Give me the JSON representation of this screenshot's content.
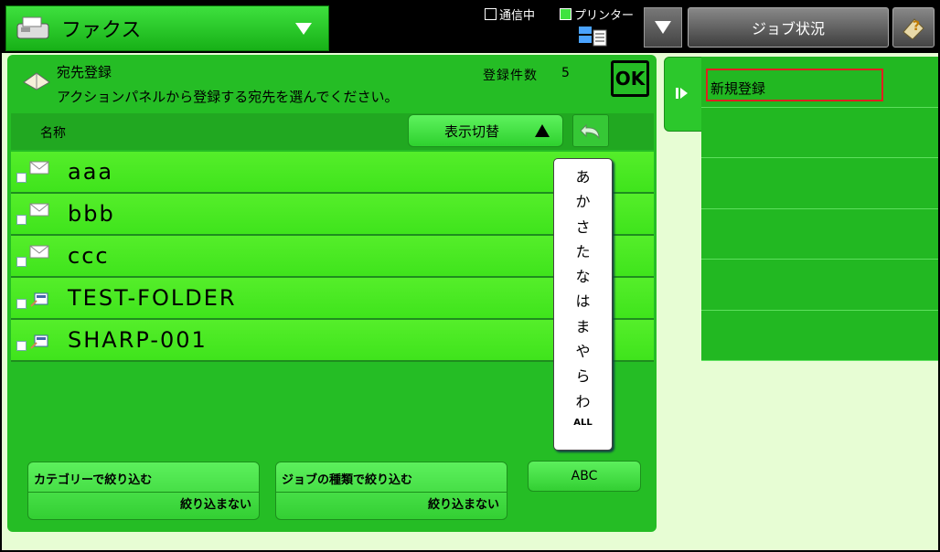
{
  "topbar": {
    "mode_label": "ファクス",
    "status_comm": "通信中",
    "status_printer": "プリンター",
    "job_status": "ジョブ状況"
  },
  "header": {
    "title": "宛先登録",
    "instruction": "アクションパネルから登録する宛先を選んでください。",
    "count_label": "登録件数",
    "count_value": "5",
    "ok_label": "OK"
  },
  "list": {
    "column_name": "名称",
    "switch_label": "表示切替",
    "rows": [
      {
        "name": "aaa",
        "type": "mail"
      },
      {
        "name": "bbb",
        "type": "mail"
      },
      {
        "name": "ccc",
        "type": "mail"
      },
      {
        "name": "TEST-FOLDER",
        "type": "folder"
      },
      {
        "name": "SHARP-001",
        "type": "folder"
      }
    ]
  },
  "index": [
    "あ",
    "か",
    "さ",
    "た",
    "な",
    "は",
    "ま",
    "や",
    "ら",
    "わ"
  ],
  "index_all": "ALL",
  "filters": {
    "category_title": "カテゴリーで絞り込む",
    "category_value": "絞り込まない",
    "jobtype_title": "ジョブの種類で絞り込む",
    "jobtype_value": "絞り込まない",
    "abc_label": "ABC"
  },
  "action_panel": {
    "items": [
      "新規登録",
      "",
      "",
      "",
      "",
      ""
    ]
  }
}
